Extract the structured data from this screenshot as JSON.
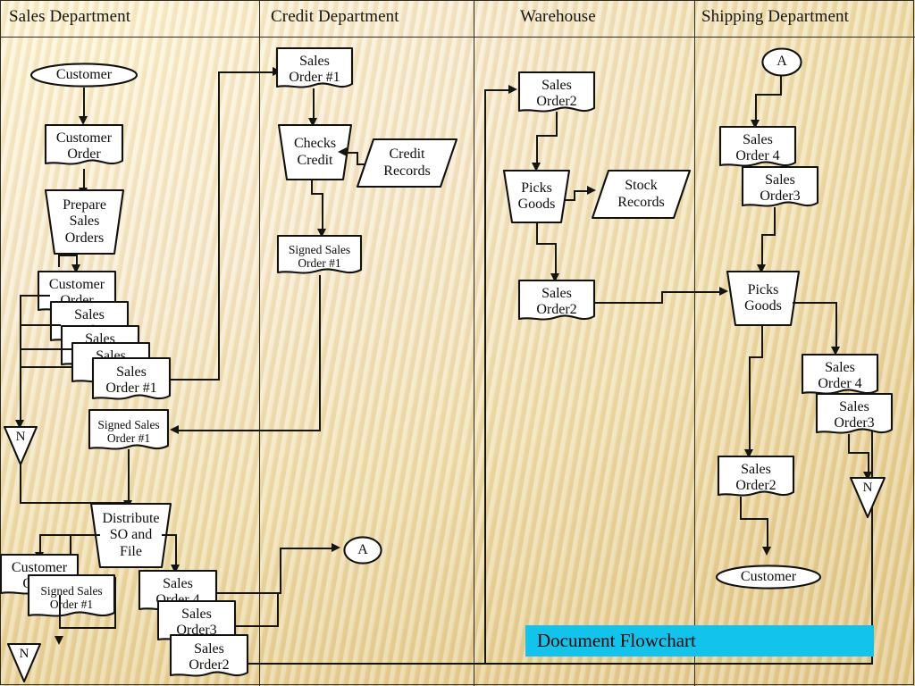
{
  "title": "Document Flowchart",
  "lanes": [
    {
      "id": "sales",
      "label": "Sales Department"
    },
    {
      "id": "credit",
      "label": "Credit Department"
    },
    {
      "id": "warehouse",
      "label": "Warehouse"
    },
    {
      "id": "shipping",
      "label": "Shipping Department"
    }
  ],
  "colors": {
    "banner_bg": "#12c3ec",
    "shape_fill": "#ffffff",
    "line": "#15150f",
    "background": "#f0dfaf"
  },
  "sales": {
    "customer_source": {
      "lines": [
        "Customer"
      ]
    },
    "customer_order": {
      "lines": [
        "Customer",
        "Order"
      ]
    },
    "prepare": {
      "lines": [
        "Prepare",
        "Sales",
        "Orders"
      ]
    },
    "stack": [
      {
        "lines": [
          "Customer",
          "Order"
        ]
      },
      {
        "lines": [
          "Sales",
          "Order"
        ]
      },
      {
        "lines": [
          "Sales",
          "Order"
        ]
      },
      {
        "lines": [
          "Sales",
          "Order"
        ]
      },
      {
        "lines": [
          "Sales",
          "Order #1"
        ]
      }
    ],
    "file_n_1": {
      "lines": [
        "N"
      ]
    },
    "signed_so1": {
      "lines": [
        "Signed Sales",
        "Order #1"
      ]
    },
    "distribute": {
      "lines": [
        "Distribute",
        "SO and",
        "File"
      ]
    },
    "customer_order_b": {
      "lines": [
        "Customer",
        "Order"
      ]
    },
    "signed_so1_b": {
      "lines": [
        "Signed Sales",
        "Order #1"
      ]
    },
    "file_n_2": {
      "lines": [
        "N"
      ]
    },
    "stack_b": [
      {
        "lines": [
          "Sales",
          "Order 4"
        ]
      },
      {
        "lines": [
          "Sales",
          "Order3"
        ]
      },
      {
        "lines": [
          "Sales",
          "Order2"
        ]
      }
    ]
  },
  "credit": {
    "so1_in": {
      "lines": [
        "Sales",
        "Order #1"
      ]
    },
    "checks": {
      "lines": [
        "Checks",
        "Credit"
      ]
    },
    "records": {
      "lines": [
        "Credit",
        "Records"
      ]
    },
    "signed_so1": {
      "lines": [
        "Signed Sales",
        "Order #1"
      ]
    },
    "connector_a": {
      "lines": [
        "A"
      ]
    }
  },
  "warehouse": {
    "so2_in": {
      "lines": [
        "Sales",
        "Order2"
      ]
    },
    "picks": {
      "lines": [
        "Picks",
        "Goods"
      ]
    },
    "stock": {
      "lines": [
        "Stock",
        "Records"
      ]
    },
    "so2_out": {
      "lines": [
        "Sales",
        "Order2"
      ]
    }
  },
  "shipping": {
    "connector_a": {
      "lines": [
        "A"
      ]
    },
    "stack_in": [
      {
        "lines": [
          "Sales",
          "Order 4"
        ]
      },
      {
        "lines": [
          "Sales",
          "Order3"
        ]
      }
    ],
    "picks": {
      "lines": [
        "Picks",
        "Goods"
      ]
    },
    "stack_out": [
      {
        "lines": [
          "Sales",
          "Order 4"
        ]
      },
      {
        "lines": [
          "Sales",
          "Order3"
        ]
      }
    ],
    "so2": {
      "lines": [
        "Sales",
        "Order2"
      ]
    },
    "file_n": {
      "lines": [
        "N"
      ]
    },
    "customer": {
      "lines": [
        "Customer"
      ]
    }
  }
}
